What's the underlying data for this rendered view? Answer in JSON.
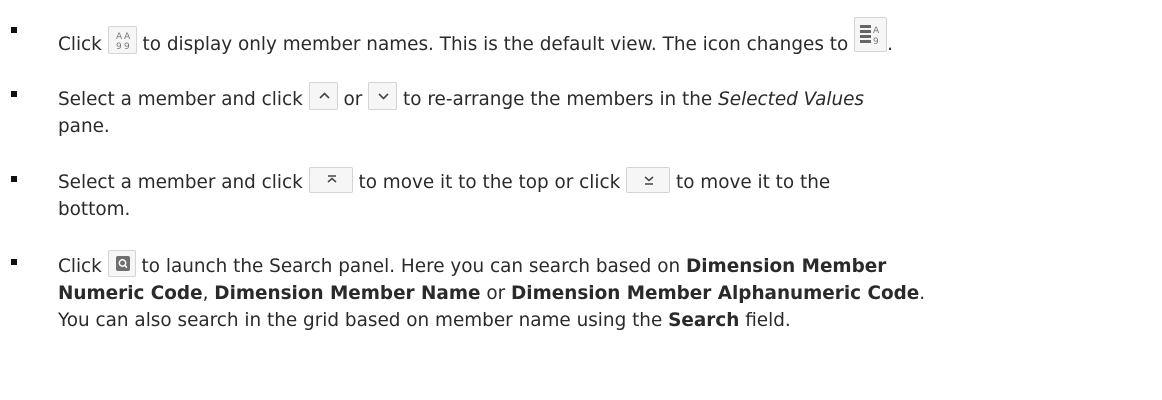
{
  "items": [
    {
      "t1": "Click",
      "t2": "to display only member names. This is the default view. The icon changes to",
      "t3": ".",
      "icon_a": "member-names-view-icon",
      "icon_b": "list-view-icon"
    },
    {
      "t1": "Select a member and click",
      "t2": "or",
      "t3": "to re-arrange the members in the",
      "t4": "Selected Values",
      "t5": "pane.",
      "icon_a": "chevron-up-icon",
      "icon_b": "chevron-down-icon"
    },
    {
      "t1": "Select a member and click",
      "t2": "to move it to the top or click",
      "t3": "to move it to the",
      "t4": "bottom.",
      "icon_a": "move-to-top-icon",
      "icon_b": "move-to-bottom-icon"
    },
    {
      "t1": "Click",
      "t2": "to launch the Search panel. Here you can search based on",
      "b1": "Dimension Member",
      "b2": "Numeric Code",
      "t3": ",",
      "b3": "Dimension Member Name",
      "t4": "or",
      "b4": "Dimension Member Alphanumeric Code",
      "t5": ".",
      "t6": "You can also search in the grid based on member name using the",
      "b5": "Search",
      "t7": "field.",
      "icon_a": "search-icon"
    }
  ]
}
